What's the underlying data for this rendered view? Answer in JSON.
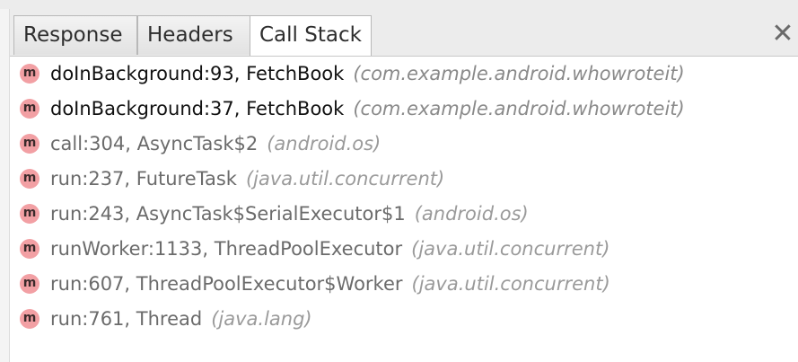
{
  "tabs": [
    {
      "label": "Response"
    },
    {
      "label": "Headers"
    },
    {
      "label": "Call Stack"
    }
  ],
  "active_tab": "Call Stack",
  "close_icon": "close-icon",
  "badge_letter": "m",
  "colors": {
    "badge": "#f2a0a4",
    "app_frame_text": "#111111",
    "library_frame_text": "#6b6b6b",
    "package_text": "#9a9a9a"
  },
  "frames": [
    {
      "method": "doInBackground:93, FetchBook",
      "package": "(com.example.android.whowroteit)",
      "app_code": true
    },
    {
      "method": "doInBackground:37, FetchBook",
      "package": "(com.example.android.whowroteit)",
      "app_code": true
    },
    {
      "method": "call:304, AsyncTask$2",
      "package": "(android.os)",
      "app_code": false
    },
    {
      "method": "run:237, FutureTask",
      "package": "(java.util.concurrent)",
      "app_code": false
    },
    {
      "method": "run:243, AsyncTask$SerialExecutor$1",
      "package": "(android.os)",
      "app_code": false
    },
    {
      "method": "runWorker:1133, ThreadPoolExecutor",
      "package": "(java.util.concurrent)",
      "app_code": false
    },
    {
      "method": "run:607, ThreadPoolExecutor$Worker",
      "package": "(java.util.concurrent)",
      "app_code": false
    },
    {
      "method": "run:761, Thread",
      "package": "(java.lang)",
      "app_code": false
    }
  ]
}
